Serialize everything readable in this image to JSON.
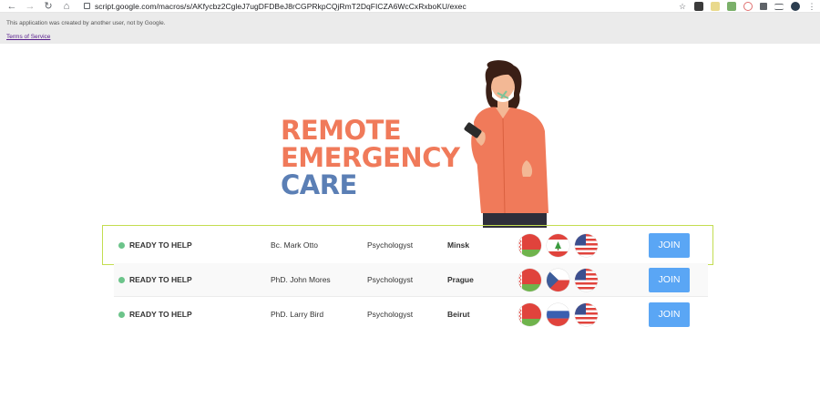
{
  "browser": {
    "url": "script.google.com/macros/s/AKfycbz2CgleJ7ugDFDBeJ8rCGPRkpCQjRmT2DqFICZA6WcCxRxboKU/exec",
    "back_icon": "←",
    "forward_icon": "→",
    "reload_icon": "↻",
    "home_icon": "⌂",
    "star_icon": "☆",
    "menu_icon": "⋮"
  },
  "banner": {
    "text": "This application was created by another user, not by Google.",
    "tos_link": "Terms of Service"
  },
  "hero": {
    "line1": "REMOTE",
    "line2": "EMERGENCY",
    "line3": "CARE"
  },
  "colors": {
    "orange": "#f07a5a",
    "blue": "#5b7fb5",
    "status_green": "#6cc48a",
    "join_blue": "#5aa6f5",
    "highlight_border": "#c3dd50"
  },
  "rows": [
    {
      "status": "READY TO HELP",
      "name": "Bc. Mark Otto",
      "role": "Psychologyst",
      "city": "Minsk",
      "flags": [
        "belarus-flag",
        "lebanon-flag",
        "usa-flag"
      ],
      "button": "JOIN"
    },
    {
      "status": "READY TO HELP",
      "name": "PhD. John Mores",
      "role": "Psychologyst",
      "city": "Prague",
      "flags": [
        "belarus-flag",
        "czech-flag",
        "usa-flag"
      ],
      "button": "JOIN"
    },
    {
      "status": "READY TO HELP",
      "name": "PhD. Larry Bird",
      "role": "Psychologyst",
      "city": "Beirut",
      "flags": [
        "belarus-flag",
        "russia-flag",
        "usa-flag"
      ],
      "button": "JOIN"
    }
  ]
}
